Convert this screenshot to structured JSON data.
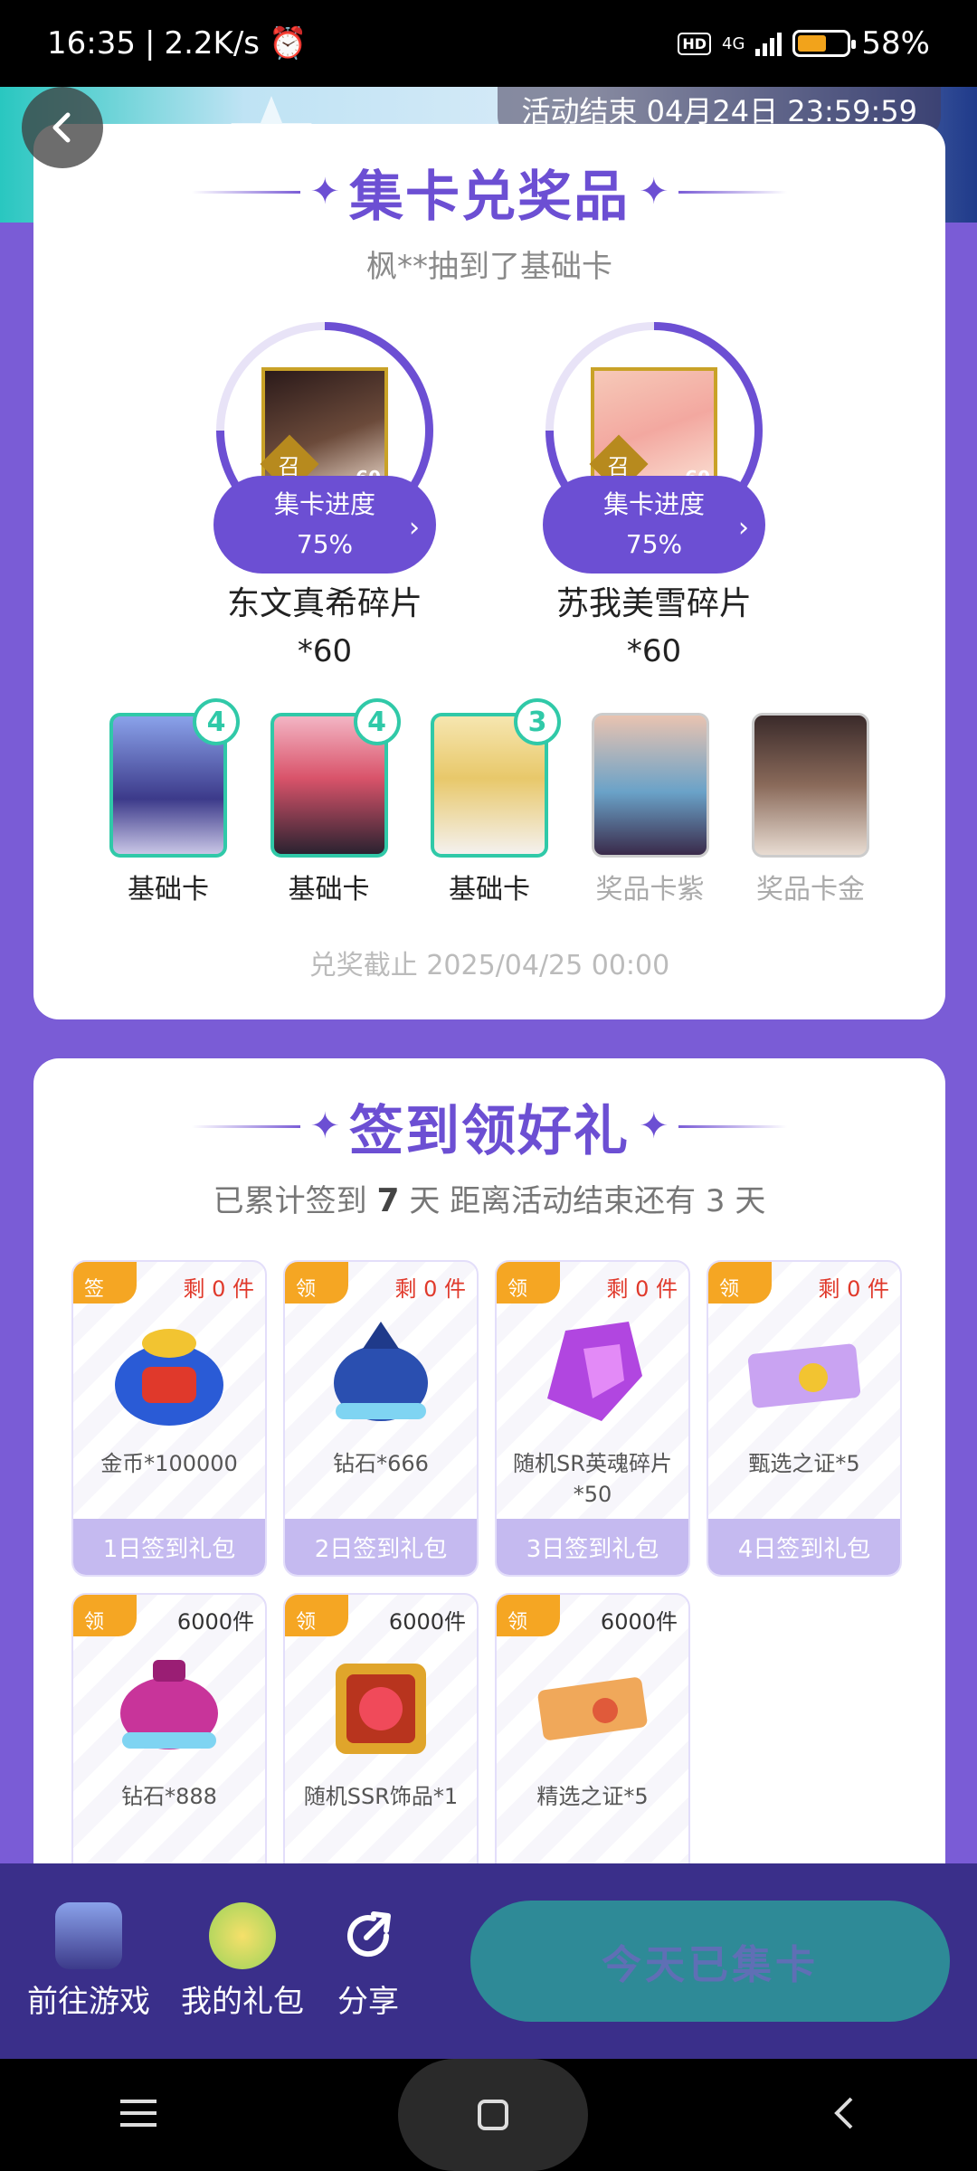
{
  "status": {
    "time": "16:35",
    "speed": "2.2K/s",
    "network": "4G",
    "battery": "58%"
  },
  "banner": {
    "end_time": "活动结束 04月24日 23:59:59"
  },
  "collect": {
    "title": "集卡兑奖品",
    "ticker": "枫**抽到了基础卡",
    "prizes": [
      {
        "progress_label": "集卡进度",
        "progress": "75%",
        "name": "东文真希碎片",
        "qty": "*60",
        "badge_char": "召",
        "level": "60"
      },
      {
        "progress_label": "集卡进度",
        "progress": "75%",
        "name": "苏我美雪碎片",
        "qty": "*60",
        "badge_char": "召",
        "level": "60"
      }
    ],
    "cards": [
      {
        "label": "基础卡",
        "count": "4"
      },
      {
        "label": "基础卡",
        "count": "4"
      },
      {
        "label": "基础卡",
        "count": "3"
      },
      {
        "label": "奖品卡紫"
      },
      {
        "label": "奖品卡金"
      }
    ],
    "deadline": "兑奖截止 2025/04/25 00:00"
  },
  "signin": {
    "title": "签到领好礼",
    "info_a": "已累计签到",
    "days": "7",
    "info_b": "天  距离活动结束还有 3 天",
    "gifts": [
      {
        "tag": "签",
        "remain": "剩 0 件",
        "name": "金币*100000",
        "bar": "1日签到礼包",
        "red": true
      },
      {
        "tag": "领",
        "remain": "剩 0 件",
        "name": "钻石*666",
        "bar": "2日签到礼包",
        "red": true
      },
      {
        "tag": "领",
        "remain": "剩 0 件",
        "name": "随机SR英魂碎片*50",
        "bar": "3日签到礼包",
        "red": true
      },
      {
        "tag": "领",
        "remain": "剩 0 件",
        "name": "甄选之证*5",
        "bar": "4日签到礼包",
        "red": true
      },
      {
        "tag": "领",
        "remain": "6000件",
        "name": "钻石*888",
        "bar": "",
        "red": false
      },
      {
        "tag": "领",
        "remain": "6000件",
        "name": "随机SSR饰品*1",
        "bar": "",
        "red": false
      },
      {
        "tag": "领",
        "remain": "6000件",
        "name": "精选之证*5",
        "bar": "",
        "red": false
      }
    ]
  },
  "bottom": {
    "goto_game": "前往游戏",
    "my_gifts": "我的礼包",
    "share": "分享",
    "cta": "今天已集卡"
  },
  "colors": {
    "accent": "#6c4fd3",
    "teal": "#30c9a8",
    "orange": "#f5a623"
  }
}
